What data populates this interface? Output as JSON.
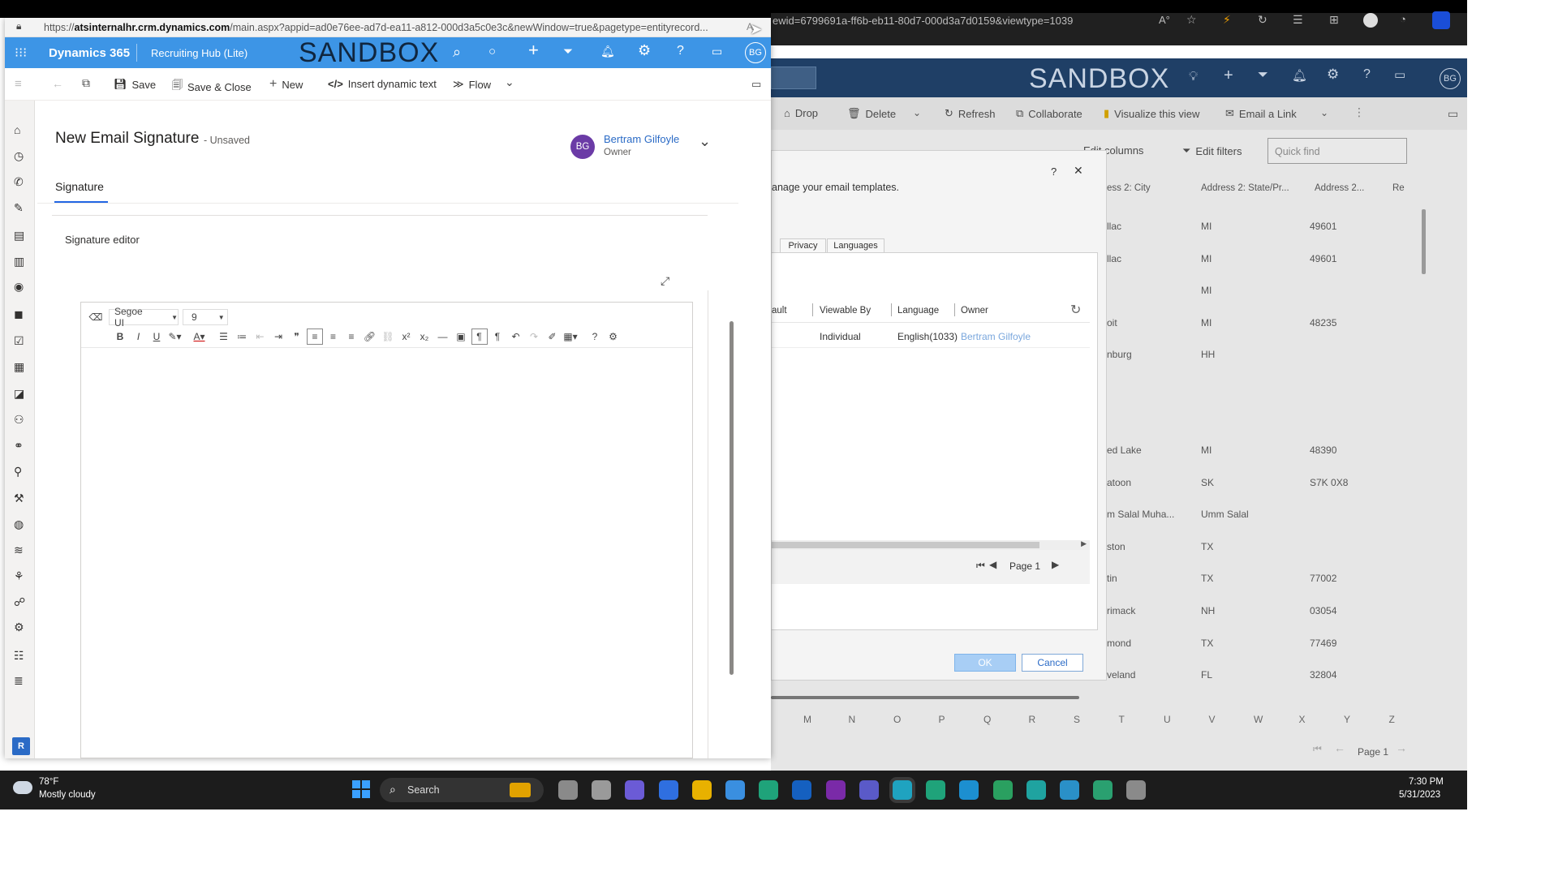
{
  "background_browser": {
    "url_fragment": "ewid=6799691a-ff6b-eb11-80d7-000d3a7d0159&viewtype=1039",
    "sandbox_label": "SANDBOX",
    "commands": [
      "Drop",
      "Delete",
      "Refresh",
      "Collaborate",
      "Visualize this view",
      "Email a Link"
    ],
    "edit_columns": "Edit columns",
    "edit_filters": "Edit filters",
    "quick_find_placeholder": "Quick find",
    "columns": [
      "ess 2: City",
      "Address 2: State/Pr...",
      "Address 2...",
      "Re"
    ],
    "rows": [
      {
        "city": "llac",
        "state": "MI",
        "zip": "49601"
      },
      {
        "city": "llac",
        "state": "MI",
        "zip": "49601"
      },
      {
        "city": "",
        "state": "MI",
        "zip": ""
      },
      {
        "city": "oit",
        "state": "MI",
        "zip": "48235"
      },
      {
        "city": "nburg",
        "state": "HH",
        "zip": ""
      },
      {
        "city": "ed Lake",
        "state": "MI",
        "zip": "48390"
      },
      {
        "city": "atoon",
        "state": "SK",
        "zip": "S7K 0X8"
      },
      {
        "city": "m Salal Muha...",
        "state": "Umm Salal",
        "zip": ""
      },
      {
        "city": "ston",
        "state": "TX",
        "zip": ""
      },
      {
        "city": "tin",
        "state": "TX",
        "zip": "77002"
      },
      {
        "city": "rimack",
        "state": "NH",
        "zip": "03054"
      },
      {
        "city": "mond",
        "state": "TX",
        "zip": "77469"
      },
      {
        "city": "veland",
        "state": "FL",
        "zip": "32804"
      }
    ],
    "letters": [
      "M",
      "N",
      "O",
      "P",
      "Q",
      "R",
      "S",
      "T",
      "U",
      "V",
      "W",
      "X",
      "Y",
      "Z"
    ],
    "page_label": "Page 1"
  },
  "modal": {
    "help": "?",
    "close": "✕",
    "description": "anage your email templates.",
    "tabs": [
      "Privacy",
      "Languages"
    ],
    "columns": [
      "ault",
      "Viewable By",
      "Language",
      "Owner"
    ],
    "row": {
      "viewable_by": "Individual",
      "language": "English(1033)",
      "owner": "Bertram Gilfoyle"
    },
    "page_label": "Page 1",
    "ok": "OK",
    "cancel": "Cancel"
  },
  "window": {
    "address_prefix": "https://",
    "address_host": "atsinternalhr.crm.dynamics.com",
    "address_path": "/main.aspx?appid=ad0e76ee-ad7d-ea11-a812-000d3a5c0e3c&newWindow=true&pagetype=entityrecord...",
    "address_right": "A"
  },
  "nav": {
    "product": "Dynamics 365",
    "app": "Recruiting Hub (Lite)",
    "sandbox": "SANDBOX",
    "avatar": "BG"
  },
  "commands": {
    "save": "Save",
    "save_close": "Save & Close",
    "new": "New",
    "insert_dynamic": "Insert dynamic text",
    "flow": "Flow"
  },
  "form": {
    "title": "New Email Signature",
    "status": "- Unsaved",
    "owner_initials": "BG",
    "owner_name": "Bertram Gilfoyle",
    "owner_label": "Owner",
    "tab": "Signature",
    "section_label": "Signature editor"
  },
  "editor": {
    "font": "Segoe UI",
    "size": "9"
  },
  "sidebar": {
    "bottom_badge": "R"
  },
  "taskbar": {
    "temperature": "78°F",
    "weather": "Mostly cloudy",
    "search": "Search",
    "time": "7:30 PM",
    "date": "5/31/2023"
  },
  "colors": {
    "nav_blue": "#3d95e6",
    "avatar_purple": "#6b3ba6",
    "link_blue": "#2b6bc6",
    "tab_underline": "#2266e3",
    "bg_header": "#1f3f66",
    "close_red": "#c42b1c"
  }
}
